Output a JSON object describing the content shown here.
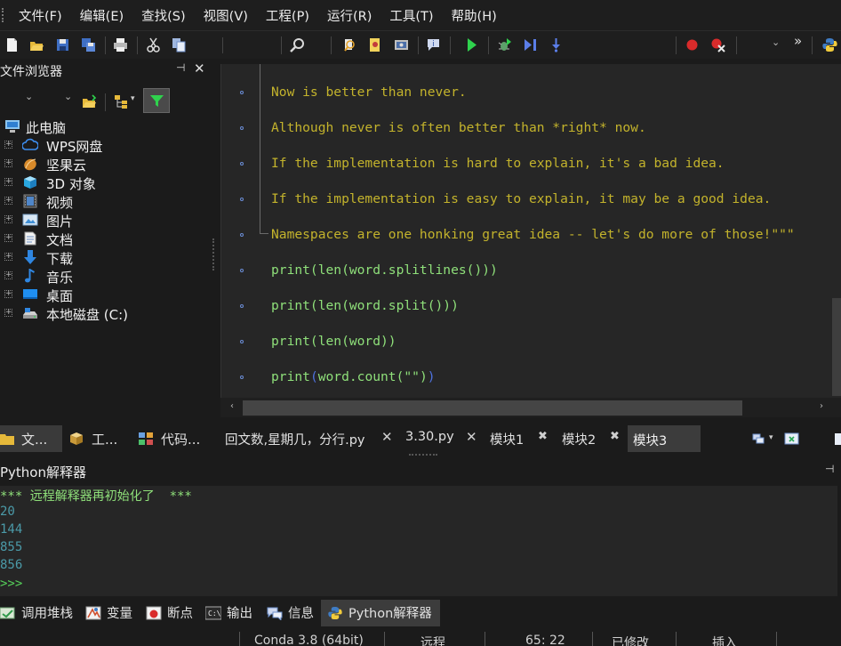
{
  "menu": {
    "items": [
      "文件(F)",
      "编辑(E)",
      "查找(S)",
      "视图(V)",
      "工程(P)",
      "运行(R)",
      "工具(T)",
      "帮助(H)"
    ]
  },
  "toolbar": {
    "overflow": "»"
  },
  "file_browser": {
    "title": "文件浏览器",
    "pin": "⊣",
    "close": "✕",
    "tree": [
      {
        "label": "此电脑",
        "icon": "computer-icon"
      },
      {
        "label": "WPS网盘",
        "icon": "cloud-icon"
      },
      {
        "label": "坚果云",
        "icon": "nut-icon"
      },
      {
        "label": "3D 对象",
        "icon": "cube-icon"
      },
      {
        "label": "视频",
        "icon": "video-icon"
      },
      {
        "label": "图片",
        "icon": "picture-icon"
      },
      {
        "label": "文档",
        "icon": "document-icon"
      },
      {
        "label": "下载",
        "icon": "download-icon"
      },
      {
        "label": "音乐",
        "icon": "music-icon"
      },
      {
        "label": "桌面",
        "icon": "desktop-icon"
      },
      {
        "label": "本地磁盘 (C:)",
        "icon": "drive-icon"
      }
    ],
    "tabs": [
      "文...",
      "工...",
      "代码..."
    ]
  },
  "editor": {
    "doc_lines": [
      "Now is better than never.",
      "Although never is often better than *right* now.",
      "If the implementation is hard to explain, it's a bad idea.",
      "If the implementation is easy to explain, it may be a good idea.",
      "Namespaces are one honking great idea -- let's do more of those!\"\"\""
    ],
    "code_lines": [
      "print(len(word.splitlines()))",
      "print(len(word.split()))",
      "print(len(word))"
    ],
    "last_line": {
      "a": "print",
      "b": "(",
      "c": "word.count(\"\")",
      "d": ")"
    },
    "tabs": [
      "回文数,星期几，分行.py",
      "3.30.py",
      "模块1",
      "模块2",
      "模块3"
    ]
  },
  "interpreter": {
    "title": "Python解释器",
    "pin": "⊣",
    "banner": "*** 远程解释器再初始化了  ***",
    "outputs": [
      "20",
      "144",
      "855",
      "856"
    ],
    "prompt": ">>>"
  },
  "bottom_tabs": [
    "调用堆栈",
    "变量",
    "断点",
    "输出",
    "信息",
    "Python解释器"
  ],
  "status": {
    "interpreter": "Conda 3.8 (64bit)",
    "mode": "远程",
    "position": "65: 22",
    "modified": "已修改",
    "insert": "插入"
  }
}
